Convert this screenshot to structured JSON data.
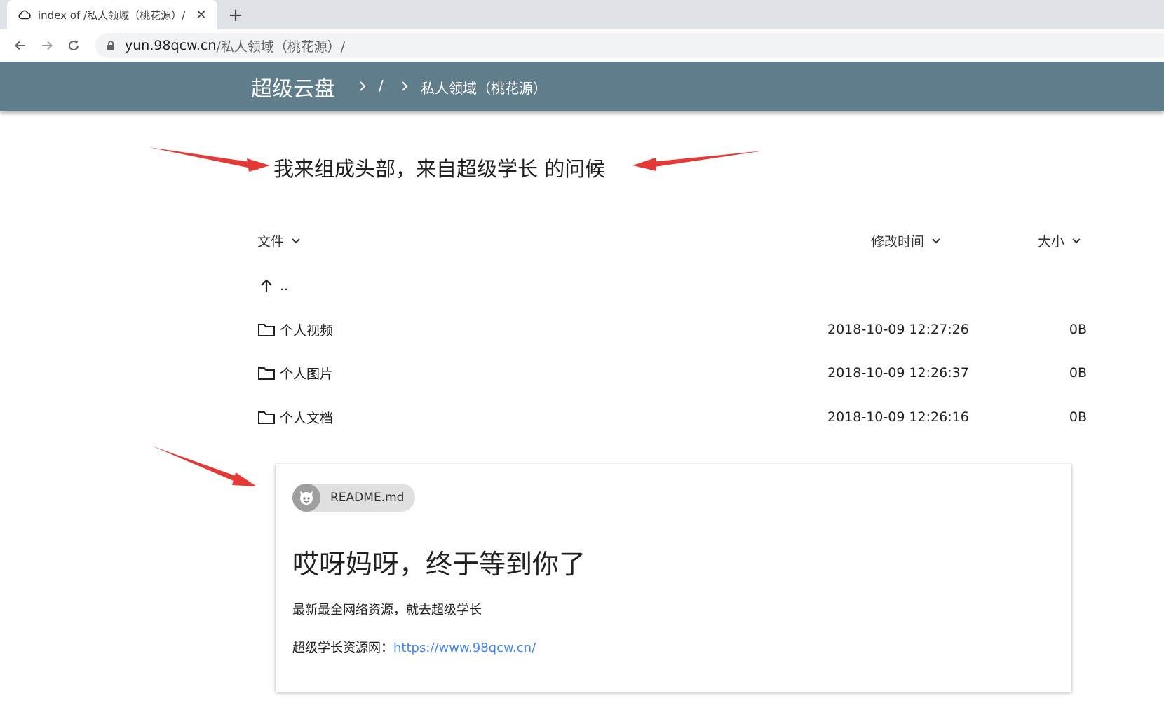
{
  "browser": {
    "tab_title": "index of /私人领域（桃花源）/",
    "new_tab": "+",
    "url_host": "yun.98qcw.cn",
    "url_path": "/私人领域（桃花源）/"
  },
  "header": {
    "brand": "超级云盘",
    "breadcrumb_sep": "/",
    "current_folder": "私人领域（桃花源）"
  },
  "greeting": "我来组成头部，来自超级学长 的问候",
  "table": {
    "columns": {
      "name": "文件",
      "modified": "修改时间",
      "size": "大小"
    },
    "parent": "..",
    "rows": [
      {
        "name": "个人视频",
        "modified": "2018-10-09 12:27:26",
        "size": "0B"
      },
      {
        "name": "个人图片",
        "modified": "2018-10-09 12:26:37",
        "size": "0B"
      },
      {
        "name": "个人文档",
        "modified": "2018-10-09 12:26:16",
        "size": "0B"
      }
    ]
  },
  "readme": {
    "chip_label": "README.md",
    "heading": "哎呀妈呀，终于等到你了",
    "line1": "最新最全网络资源，就去超级学长",
    "line2_prefix": "超级学长资源网：",
    "line2_link": "https://www.98qcw.cn/"
  },
  "colors": {
    "header_bg": "#607d8b",
    "link": "#4285f4",
    "annotation_arrow": "#e53935"
  },
  "icons": {
    "favicon": "cloud-icon",
    "back": "back-arrow-icon",
    "forward": "forward-arrow-icon",
    "reload": "reload-icon",
    "lock": "lock-icon",
    "folder": "folder-icon",
    "up": "up-arrow-icon",
    "sort": "chevron-down-icon"
  }
}
